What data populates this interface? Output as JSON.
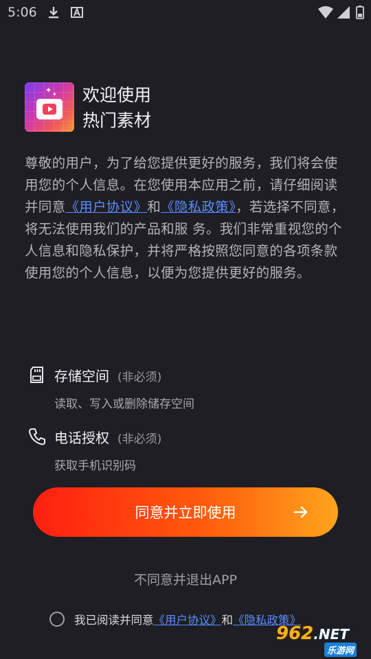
{
  "status_bar": {
    "time": "5:06"
  },
  "app": {
    "welcome_line1": "欢迎使用",
    "welcome_line2": "热门素材"
  },
  "intro": {
    "part1": "尊敬的用户，为了给您提供更好的服务，我们将会使用您的个人信息。在您使用本应用之前，请仔细阅读并同意",
    "link_user_agreement": "《用户协议》",
    "and": "和",
    "link_privacy": "《隐私政策》",
    "part2": "，若选择不同意，将无法使用我们的产品和服 务。我们非常重视您的个人信息和隐私保护，并将严格按照您同意的各项条款使用您的个人信息，以便为您提供更好的服务。"
  },
  "permissions": [
    {
      "title": "存储空间",
      "tag": "(非必须)",
      "desc": "读取、写入或删除储存空间",
      "icon": "sd-card-icon"
    },
    {
      "title": "电话授权",
      "tag": "(非必须)",
      "desc": "获取手机识别码",
      "icon": "phone-icon"
    }
  ],
  "buttons": {
    "agree": "同意并立即使用",
    "decline": "不同意并退出APP"
  },
  "consent": {
    "prefix": "我已阅读并同意",
    "link_user_agreement": "《用户协议》",
    "and": "和",
    "link_privacy": "《隐私政策》"
  },
  "watermark": {
    "main": "962",
    "net": ".NET",
    "sub": "乐游网"
  },
  "colors": {
    "background": "#1e1e24",
    "link": "#5b8cff",
    "button_start": "#ff1f10",
    "button_end": "#ffa41c"
  }
}
